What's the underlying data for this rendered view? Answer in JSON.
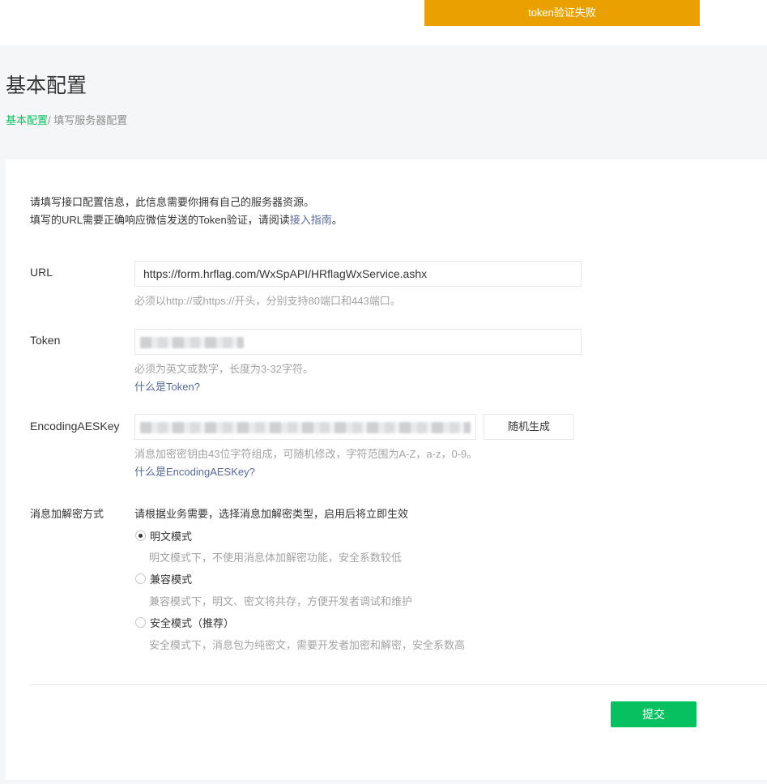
{
  "toast": {
    "text": "token验证失败",
    "color": "#e9a100"
  },
  "page": {
    "title": "基本配置",
    "breadcrumb": {
      "parent": "基本配置",
      "separator": "/ ",
      "current": "填写服务器配置"
    }
  },
  "intro": {
    "line1": "请填写接口配置信息，此信息需要你拥有自己的服务器资源。",
    "line2_prefix": "填写的URL需要正确响应微信发送的Token验证，请阅读",
    "line2_link": "接入指南",
    "line2_suffix": "。"
  },
  "form": {
    "url": {
      "label": "URL",
      "value": "https://form.hrflag.com/WxSpAPI/HRflagWxService.ashx",
      "hint": "必须以http://或https://开头，分别支持80端口和443端口。"
    },
    "token": {
      "label": "Token",
      "hint": "必须为英文或数字，长度为3-32字符。",
      "help_link": "什么是Token?"
    },
    "aes_key": {
      "label": "EncodingAESKey",
      "random_button": "随机生成",
      "hint": "消息加密密钥由43位字符组成，可随机修改，字符范围为A-Z，a-z，0-9。",
      "help_link": "什么是EncodingAESKey?"
    },
    "encryption": {
      "label": "消息加解密方式",
      "description": "请根据业务需要，选择消息加解密类型，启用后将立即生效",
      "options": [
        {
          "label": "明文模式",
          "desc": "明文模式下，不使用消息体加解密功能，安全系数较低",
          "checked": true
        },
        {
          "label": "兼容模式",
          "desc": "兼容模式下，明文、密文将共存，方便开发者调试和维护",
          "checked": false
        },
        {
          "label": "安全模式（推荐）",
          "desc": "安全模式下，消息包为纯密文，需要开发者加密和解密，安全系数高",
          "checked": false
        }
      ]
    },
    "submit": "提交"
  },
  "colors": {
    "accent": "#07c160",
    "link": "#576b95",
    "warning": "#e9a100"
  }
}
